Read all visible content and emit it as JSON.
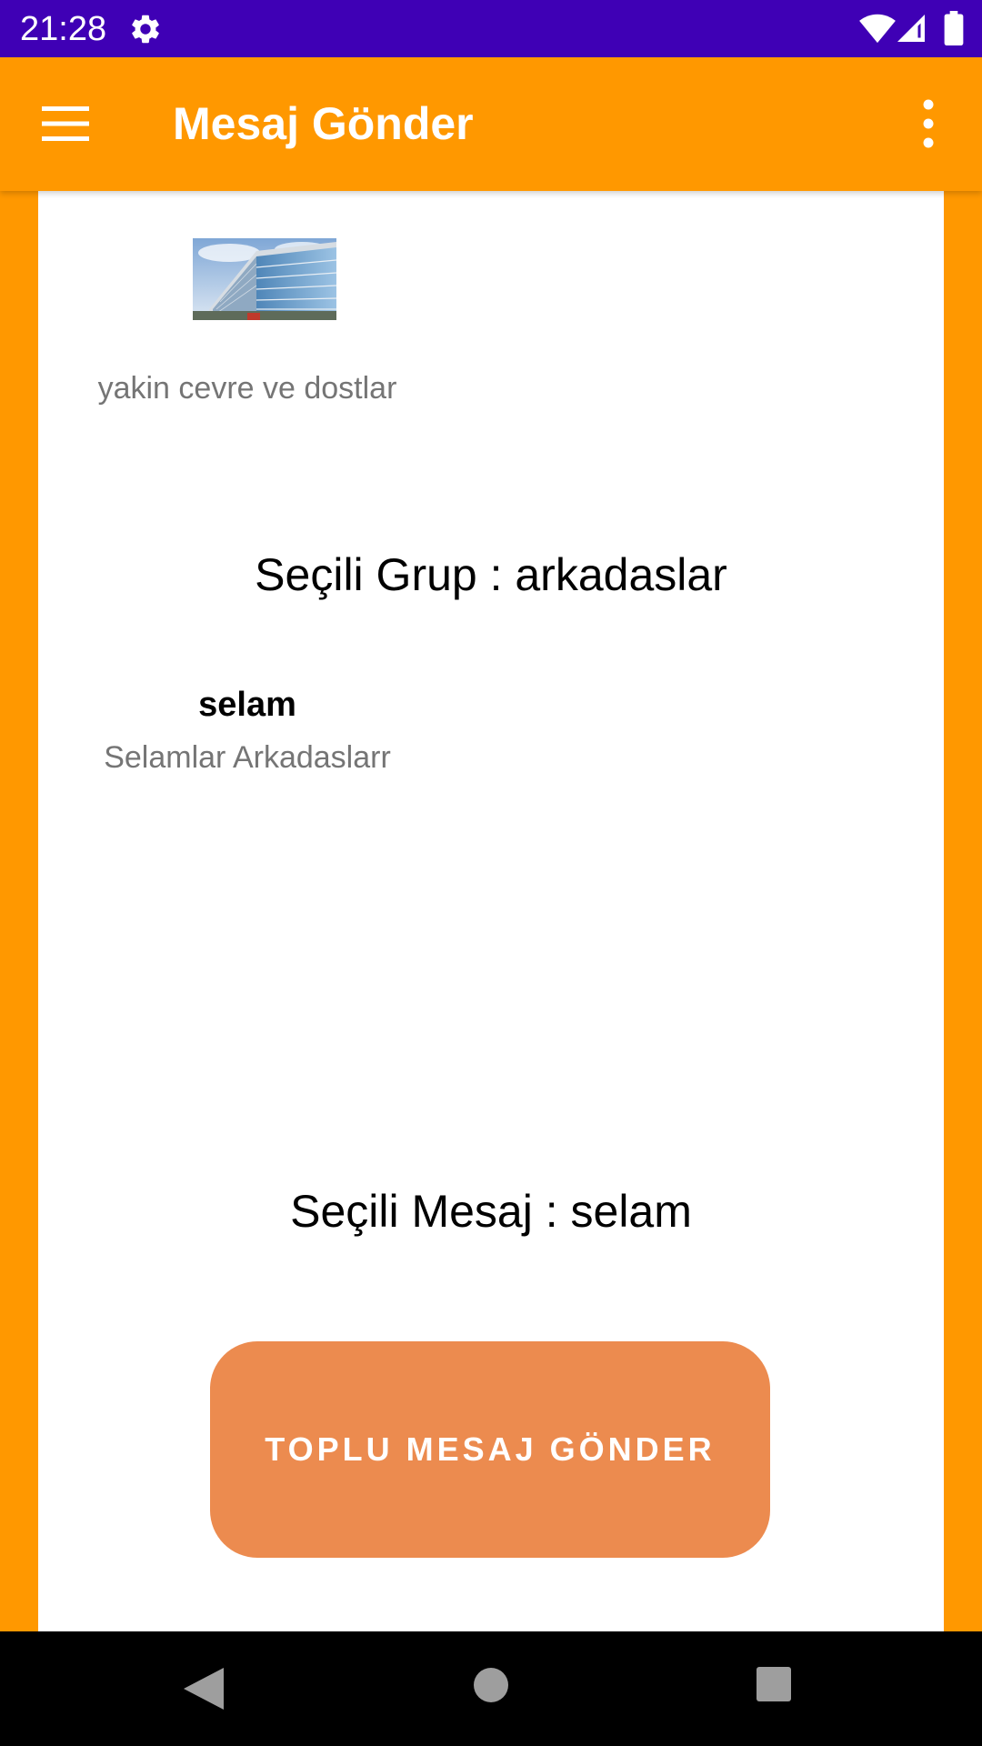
{
  "status_bar": {
    "time": "21:28",
    "icons": [
      "gear-icon",
      "wifi-icon",
      "signal-icon",
      "battery-icon"
    ]
  },
  "app_bar": {
    "title": "Mesaj Gönder",
    "icons": [
      "menu-icon",
      "overflow-menu-icon"
    ]
  },
  "groups": [
    {
      "name": "yakin cevre ve dostlar",
      "image": "building-photo"
    }
  ],
  "selected_group_text": "Seçili Grup : arkadaslar",
  "messages": [
    {
      "title": "selam",
      "body": "Selamlar Arkadaslarr"
    }
  ],
  "selected_message_text": "Seçili Mesaj : selam",
  "send_button_label": "TOPLU MESAJ GÖNDER",
  "nav_bar": {
    "icons": [
      "back-icon",
      "home-icon",
      "recent-apps-icon"
    ]
  },
  "colors": {
    "status_bar": "#3F00B5",
    "app_bar": "#FF9800",
    "send_button": "#EC8B4F",
    "secondary_text": "#757575"
  }
}
